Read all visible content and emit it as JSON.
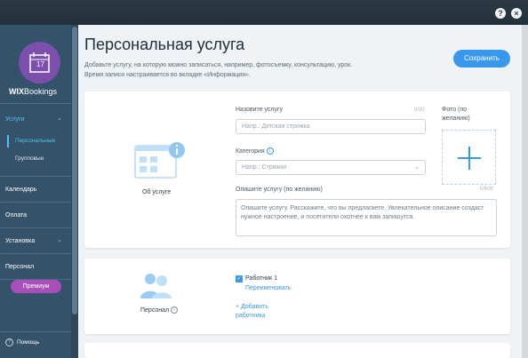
{
  "topbar": {
    "help_glyph": "?",
    "close_glyph": "×"
  },
  "sidebar": {
    "logo_number": "17",
    "brand_wix": "WIX",
    "brand_name": "Bookings",
    "services": {
      "label": "Услуги",
      "chevron": "⌄"
    },
    "sub_items": [
      {
        "label": "Персональные"
      },
      {
        "label": "Групповые"
      }
    ],
    "calendar": "Календарь",
    "payment": "Оплата",
    "settings": {
      "label": "Установка",
      "chevron": "⌄"
    },
    "staff": "Персонал",
    "premium": "Премиум",
    "help": "Помощь",
    "help_glyph": "?"
  },
  "page": {
    "title": "Персональная услуга",
    "description": "Добавьте услугу, на которую можно записаться, например, фотосъемку, консультацию, урок. Время записи настраивается во вкладке «Информация».",
    "save_button": "Сохранить"
  },
  "about": {
    "caption": "Об услуге",
    "name_label": "Назовите услугу",
    "name_counter": "0/30",
    "name_placeholder": "Напр.: Детская стрижка",
    "category_label": "Категория",
    "category_placeholder": "Напр.: Стрижки",
    "description_label": "Опишите услугу (по желанию)",
    "description_counter": "0/600",
    "description_placeholder": "Опишите услугу. Расскажите, что вы предлагаете. Увлекательное описание создаст нужное настроение, и посетители охотнее к вам запишутся.",
    "photo_label": "Фото (по желанию)",
    "info_glyph": "i"
  },
  "staff": {
    "caption": "Персонал",
    "info_glyph": "i",
    "worker_name": "Работник 1",
    "rename_link": "Переименовать",
    "add_worker_link": "+ Добавить работника",
    "checkbox_glyph": "✓"
  },
  "colors": {
    "accent": "#3899ec",
    "sidebar_bg": "#34526a",
    "premium": "#a84fb9",
    "logo_bg": "#7b4fab"
  }
}
